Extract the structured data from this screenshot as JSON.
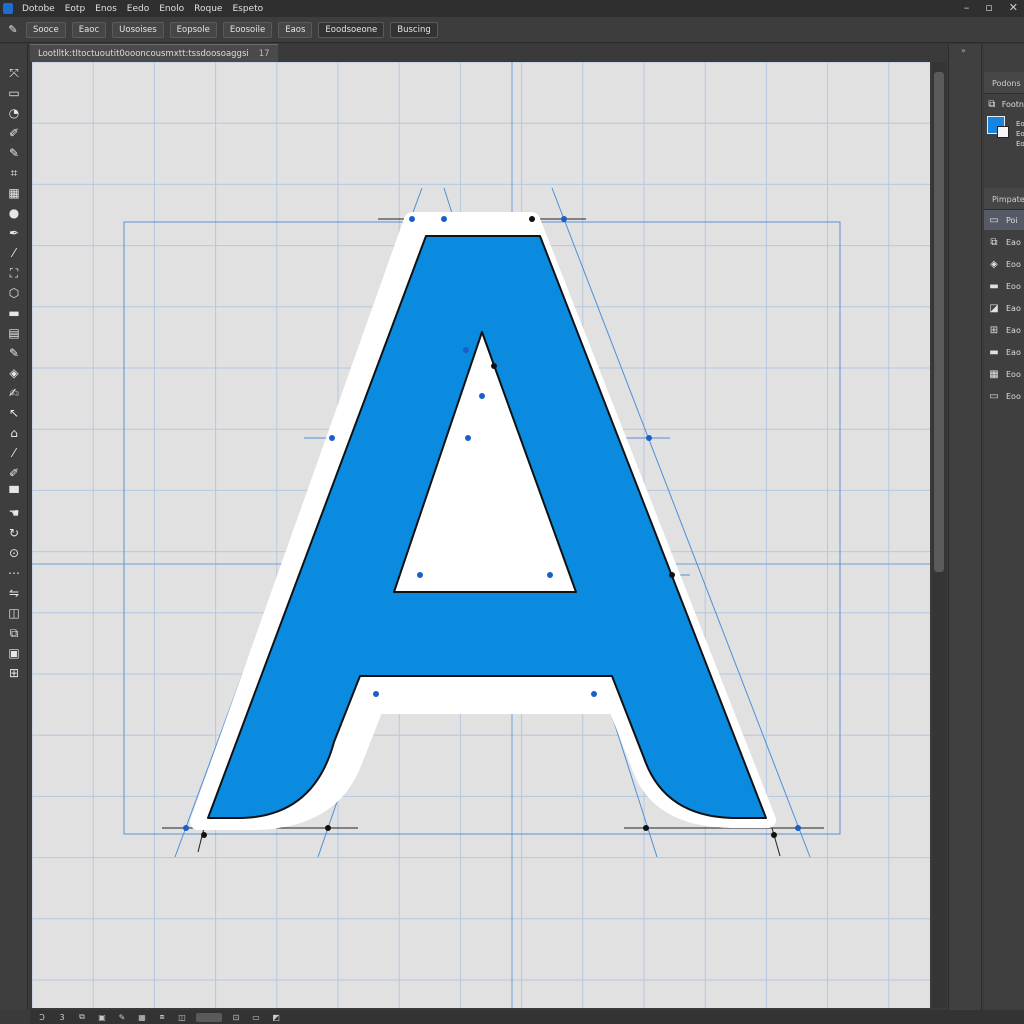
{
  "menu": {
    "items": [
      "Dotobe",
      "Eotp",
      "Enos",
      "Eedo",
      "Enolo",
      "Roque",
      "Espeto"
    ]
  },
  "options": {
    "tool_icon": "pen-tool-icon",
    "buttons": [
      "Sooce",
      "Eaoc",
      "Uosoises",
      "Eopsole",
      "Eoosoile",
      "Eaos",
      "Eoodsoeone",
      "Buscing"
    ]
  },
  "document": {
    "tab_title": "Lootlltk:tltoctuoutit0oooncousmxtt:tssdoosoaggsi",
    "tab_close": "17"
  },
  "panels": {
    "color_header": "Podons",
    "color_row_label": "Footn",
    "swatch_labels": [
      "Eo",
      "Eo",
      "Eoe"
    ],
    "layers_header": "Pimpateo",
    "layers": [
      {
        "label": "Poi",
        "icon": "rectangle-icon",
        "active": true
      },
      {
        "label": "Eao",
        "icon": "layer-stack-icon",
        "active": false
      },
      {
        "label": "Eoo",
        "icon": "paint-bucket-icon",
        "active": false
      },
      {
        "label": "Eoo",
        "icon": "folder-icon",
        "active": false
      },
      {
        "label": "Eao",
        "icon": "layer-mask-icon",
        "active": false
      },
      {
        "label": "Eao",
        "icon": "adjustment-icon",
        "active": false
      },
      {
        "label": "Eao",
        "icon": "folder-icon",
        "active": false
      },
      {
        "label": "Eoo",
        "icon": "grid-icon",
        "active": false
      },
      {
        "label": "Eoo",
        "icon": "frame-icon",
        "active": false
      }
    ]
  },
  "status": {
    "items": [
      "Ɔ",
      "3"
    ]
  },
  "colors": {
    "foreground": "#1585e0",
    "background": "#f6f6f6",
    "glyph_fill": "#0b8be0",
    "guide": "#4f8fd6"
  }
}
